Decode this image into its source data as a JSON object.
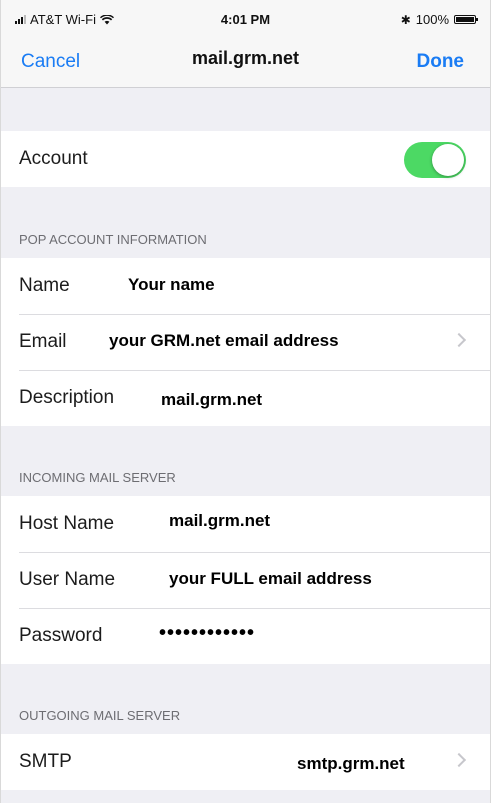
{
  "status_bar": {
    "carrier": "AT&T Wi-Fi",
    "time": "4:01 PM",
    "battery": "100%"
  },
  "nav": {
    "cancel_label": "Cancel",
    "title": "mail.grm.net",
    "done_label": "Done"
  },
  "account": {
    "label": "Account",
    "toggle_on": true,
    "toggle_color": "#4cd964"
  },
  "pop_section": {
    "header": "POP ACCOUNT INFORMATION",
    "name_label": "Name",
    "name_value": "Your name",
    "email_label": "Email",
    "email_value": "your GRM.net email address",
    "description_label": "Description",
    "description_value": "mail.grm.net"
  },
  "incoming_section": {
    "header": "INCOMING MAIL SERVER",
    "host_label": "Host Name",
    "host_value": "mail.grm.net",
    "user_label": "User Name",
    "user_value": "your FULL email address",
    "password_label": "Password",
    "password_value": "••••••••••••"
  },
  "outgoing_section": {
    "header": "OUTGOING MAIL SERVER",
    "smtp_label": "SMTP",
    "smtp_value": "smtp.grm.net"
  },
  "colors": {
    "accent": "#1a7cf4",
    "background": "#efeff4"
  }
}
